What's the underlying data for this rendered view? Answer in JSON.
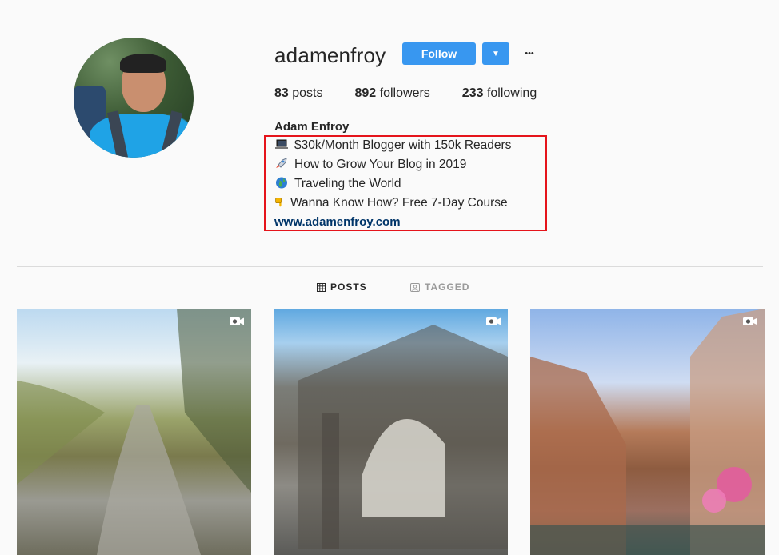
{
  "profile": {
    "username": "adamenfroy",
    "follow_label": "Follow",
    "dropdown_glyph": "▼",
    "more_glyph": "•••",
    "stats": [
      {
        "count": "83",
        "label": "posts"
      },
      {
        "count": "892",
        "label": "followers"
      },
      {
        "count": "233",
        "label": "following"
      }
    ],
    "full_name": "Adam Enfroy",
    "bio": [
      {
        "icon": "laptop-icon",
        "text": "$30k/Month Blogger with 150k Readers"
      },
      {
        "icon": "rocket-icon",
        "text": "How to Grow Your Blog in 2019"
      },
      {
        "icon": "globe-icon",
        "text": "Traveling the World"
      },
      {
        "icon": "pointing-down-icon",
        "text": "Wanna Know How? Free 7-Day Course"
      }
    ],
    "website": "www.adamenfroy.com"
  },
  "tabs": [
    {
      "label": "POSTS",
      "icon": "grid-icon",
      "active": true
    },
    {
      "label": "TAGGED",
      "icon": "tag-icon",
      "active": false
    }
  ],
  "posts": [
    {
      "type": "video",
      "icon": "video-camera-icon"
    },
    {
      "type": "video",
      "icon": "video-camera-icon"
    },
    {
      "type": "video",
      "icon": "video-camera-icon"
    }
  ],
  "colors": {
    "accent": "#3897f0",
    "highlight_box": "#e5141b",
    "link": "#003569",
    "background": "#fafafa"
  }
}
